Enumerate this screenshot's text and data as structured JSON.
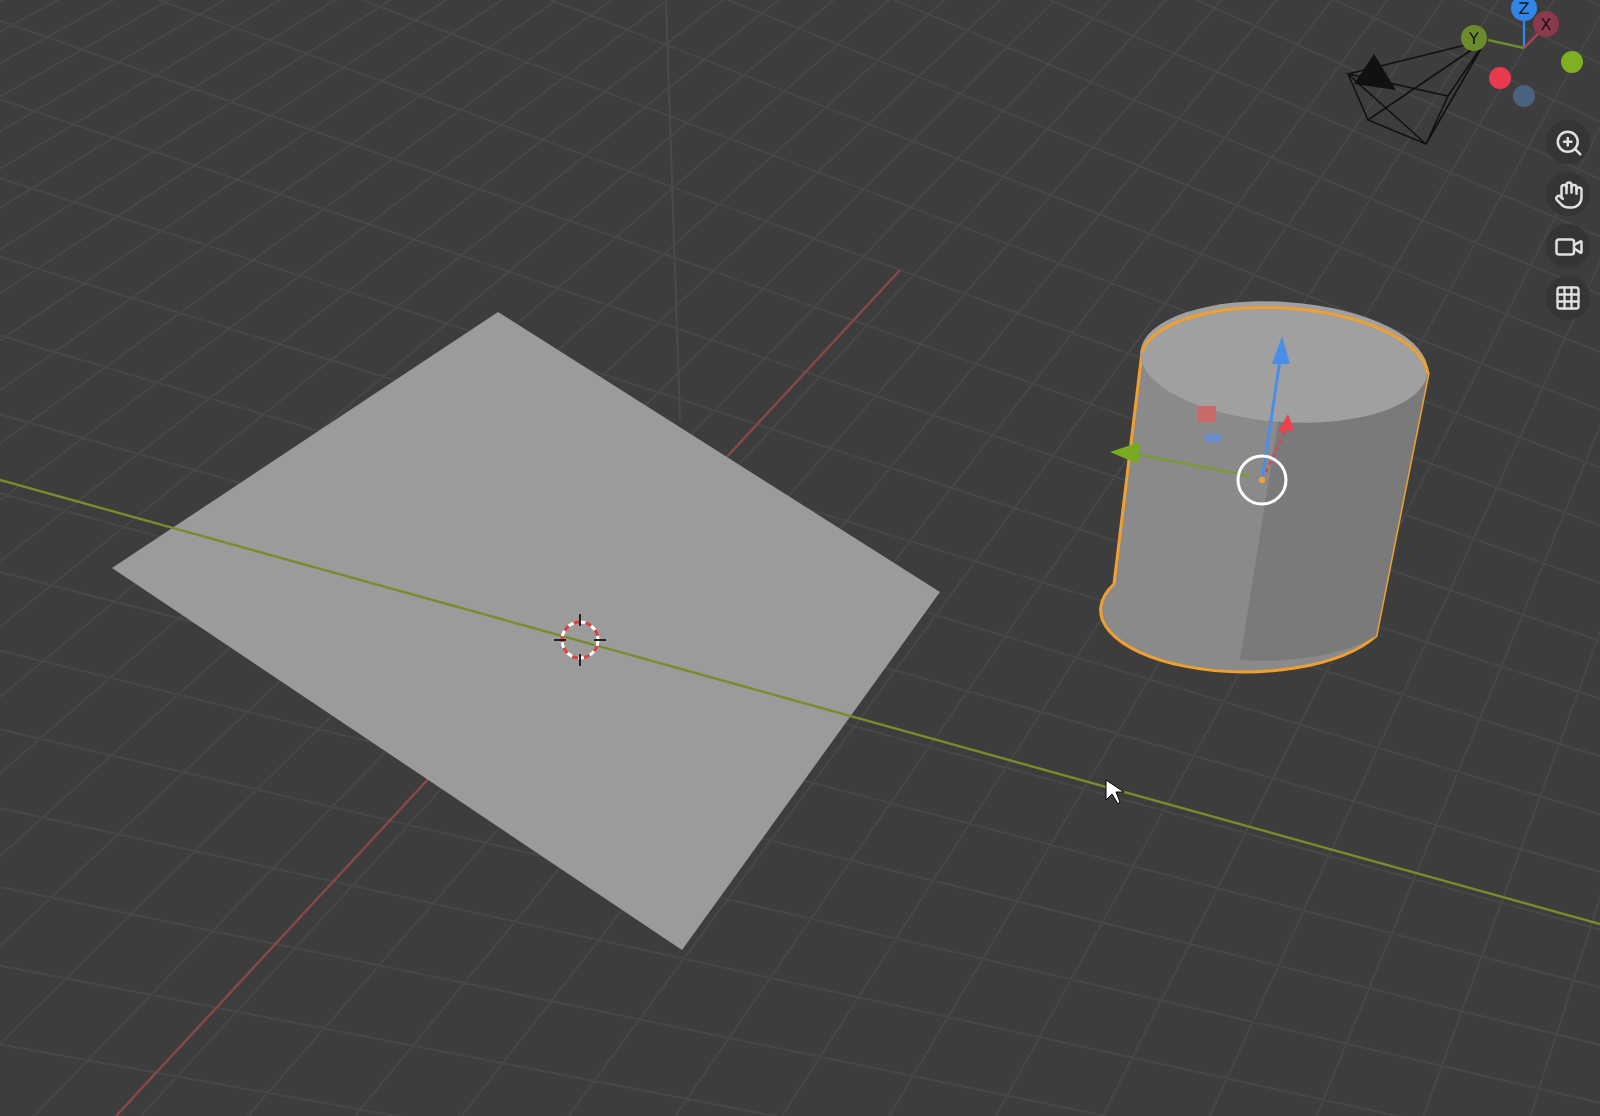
{
  "navigation_gizmo": {
    "axes": [
      {
        "label": "Z",
        "color": "#2f86e6"
      },
      {
        "label": "X",
        "color": "#8a3a48"
      },
      {
        "label": "Y",
        "color": "#6a8c2c"
      }
    ]
  }
}
